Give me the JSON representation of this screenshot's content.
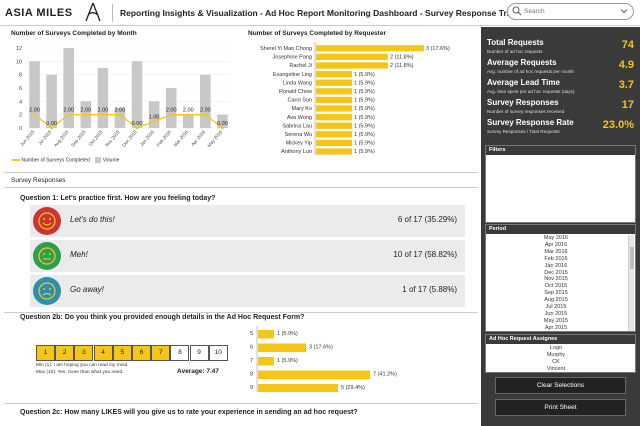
{
  "header": {
    "logo_text": "ASIA MILES",
    "title": "Reporting Insights & Visualization - Ad Hoc Report Monitoring Dashboard - Survey Response Tracking",
    "search_placeholder": "Search"
  },
  "monthly_chart": {
    "title": "Number of Surveys Completed by Month",
    "legend_line": "Number of Surveys Completed",
    "legend_bar": "Volume"
  },
  "requester_chart": {
    "title": "Number of Surveys Completed by Requester"
  },
  "chart_data": [
    {
      "type": "bar",
      "title": "Number of Surveys Completed by Month",
      "categories": [
        "Jun 2015",
        "Jul 2015",
        "Aug 2015",
        "Sep 2015",
        "Oct 2015",
        "Nov 2015",
        "Dec 2015",
        "Jan 2016",
        "Feb 2016",
        "Mar 2016",
        "Apr 2016",
        "May 2016"
      ],
      "ylim": [
        0,
        12
      ],
      "yticks": [
        0,
        2,
        4,
        6,
        8,
        10,
        12
      ],
      "series": [
        {
          "name": "Volume",
          "type": "bar",
          "values": [
            10,
            8,
            12,
            4,
            9,
            3,
            10,
            4,
            6,
            2,
            8,
            2
          ]
        },
        {
          "name": "Number of Surveys Completed",
          "type": "line",
          "values": [
            2,
            0,
            2,
            2,
            2,
            2,
            0,
            1,
            2,
            2,
            2,
            0
          ]
        }
      ],
      "data_labels": [
        "2.00",
        "0.00",
        "2.00",
        "2.00",
        "2.00",
        "2.00",
        "0.00",
        "1.00",
        "2.00",
        "2.00",
        "2.00",
        "0.00"
      ]
    },
    {
      "type": "bar",
      "orientation": "horizontal",
      "title": "Number of Surveys Completed by Requester",
      "categories": [
        "Sherel Yi Man Chong",
        "Josephine Pang",
        "Rachel Ji",
        "Evangeline Ling",
        "Linda Wang",
        "Ronald Chow",
        "Carol Sun",
        "Mary Ko",
        "Ava Wong",
        "Sabrina Lau",
        "Serena Wu",
        "Mickey Yip",
        "Anthony Lun"
      ],
      "values": [
        3,
        2,
        2,
        1,
        1,
        1,
        1,
        1,
        1,
        1,
        1,
        1,
        1
      ],
      "data_labels": [
        "3 (17.6%)",
        "2 (11.8%)",
        "2 (11.8%)",
        "1 (5.9%)",
        "1 (5.9%)",
        "1 (5.9%)",
        "1 (5.9%)",
        "1 (5.9%)",
        "1 (5.9%)",
        "1 (5.9%)",
        "1 (5.9%)",
        "1 (5.9%)",
        "1 (5.9%)"
      ]
    },
    {
      "type": "bar",
      "orientation": "horizontal",
      "title": "Question 2b",
      "categories": [
        "5",
        "6",
        "7",
        "8",
        "9"
      ],
      "values": [
        1,
        3,
        1,
        7,
        5
      ],
      "data_labels": [
        "1  (5.9%)",
        "3  (17.6%)",
        "1  (5.9%)",
        "7  (41.2%)",
        "5  (29.4%)"
      ]
    }
  ],
  "survey": {
    "section_title": "Survey Responses",
    "q1": {
      "text": "Question 1: Let's practice first. How are you feeling today?",
      "responses": [
        {
          "label": "Let's do this!",
          "count": "6 of 17 (35.29%)",
          "color": "#cc3333"
        },
        {
          "label": "Meh!",
          "count": "10 of 17 (58.82%)",
          "color": "#2e9e52"
        },
        {
          "label": "Go away!",
          "count": "1 of 17 (5.88%)",
          "color": "#2a8fb0"
        }
      ]
    },
    "q2b": {
      "text": "Question 2b: Do you think you provided enough details in the Ad Hoc Request Form?",
      "scale": [
        "1",
        "2",
        "3",
        "4",
        "5",
        "6",
        "7",
        "8",
        "9",
        "10"
      ],
      "filled_upto": 7.47,
      "note_min": "Min (1): I am hoping you can read my mind.",
      "note_max": "Max (10): Yes, more than what you need.",
      "average": "Average: 7.47"
    },
    "q2c": {
      "text": "Question 2c: How many LIKES will you give us to rate your experience in sending an ad hoc request?"
    }
  },
  "sidebar": {
    "kpis": [
      {
        "label": "Total Requests",
        "sub": "Number of ad hoc requests",
        "value": "74"
      },
      {
        "label": "Average Requests",
        "sub": "Avg. number of ad hoc requests per month",
        "value": "4.9"
      },
      {
        "label": "Average Lead Time",
        "sub": "Avg. time spent per ad hoc requests (days)",
        "value": "3.7"
      },
      {
        "label": "Survey Responses",
        "sub": "Number of survey responses received",
        "value": "17"
      },
      {
        "label": "Survey Response Rate",
        "sub": "Survey Responses / Total Requests",
        "value": "23.0%"
      }
    ],
    "filters_title": "Filters",
    "period_title": "Period",
    "periods": [
      "May 2016",
      "Apr 2016",
      "Mar 2016",
      "Feb 2016",
      "Jan 2016",
      "Dec 2015",
      "Nov 2015",
      "Oct 2015",
      "Sep 2015",
      "Aug 2015",
      "Jul 2015",
      "Jun 2015",
      "May 2015",
      "Apr 2015"
    ],
    "assignee_title": "Ad Hoc Request Assignee",
    "assignees": [
      "Logo",
      "Murphy",
      "CK",
      "Vincent"
    ],
    "clear_button": "Clear Selections",
    "print_button": "Print Sheet"
  },
  "colors": {
    "accent": "#f5c518",
    "bar_gray": "#c8c8c8",
    "sidebar_bg": "#3a3a3a",
    "kpi_value": "#f5c518"
  }
}
